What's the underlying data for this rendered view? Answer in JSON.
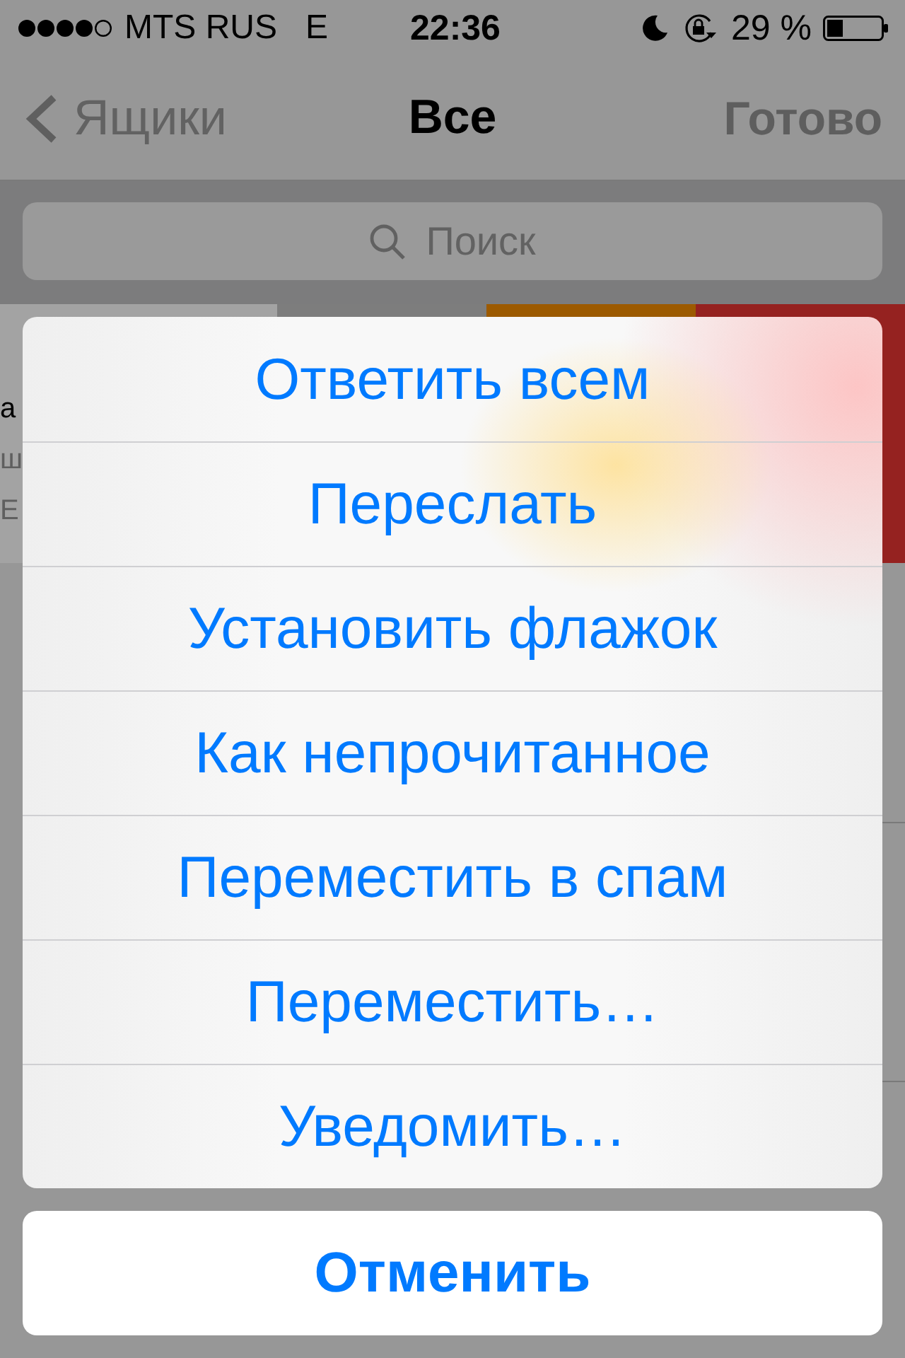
{
  "status_bar": {
    "carrier": "MTS RUS",
    "network": "E",
    "time": "22:36",
    "battery": "29 %"
  },
  "nav_bar": {
    "back": "Ящики",
    "title": "Все",
    "done": "Готово"
  },
  "search": {
    "placeholder": "Поиск"
  },
  "message_row": {
    "text_fragments": [
      "а",
      "ш",
      "E"
    ],
    "swipe_actions": [
      {
        "color": "#7d7d7d"
      },
      {
        "color": "#9c5a00"
      },
      {
        "color": "#952220"
      }
    ]
  },
  "action_sheet": {
    "items": [
      "Ответить всем",
      "Переслать",
      "Установить флажок",
      "Как непрочитанное",
      "Переместить в спам",
      "Переместить…",
      "Уведомить…"
    ],
    "cancel": "Отменить"
  }
}
